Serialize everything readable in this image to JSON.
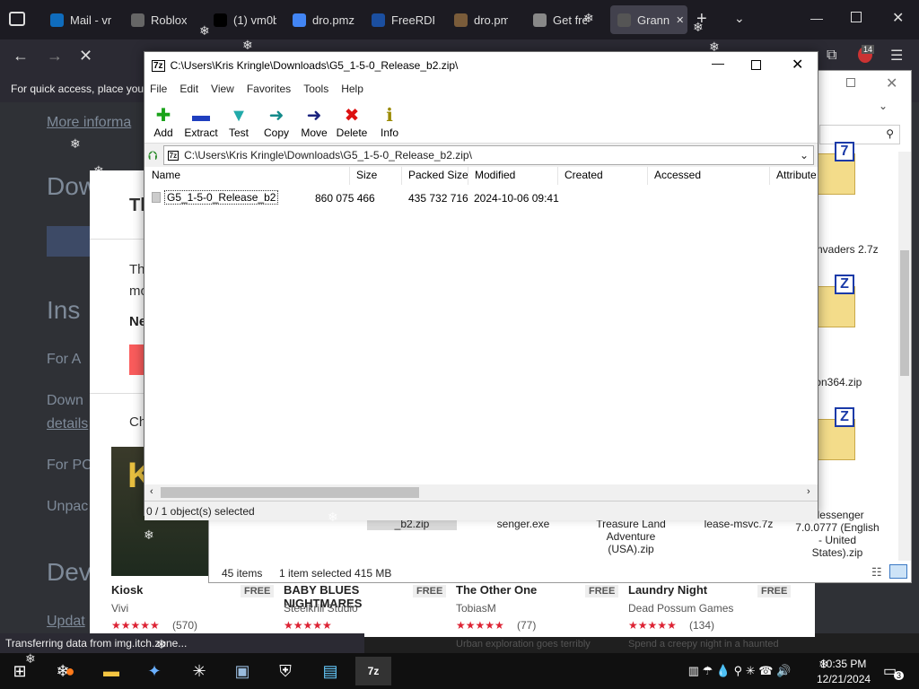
{
  "browser": {
    "tabs": [
      {
        "label": "Mail - vr",
        "icon": "mail-icon",
        "color": "#0f6cbd"
      },
      {
        "label": "Roblox",
        "icon": "roblox-icon",
        "color": "#666"
      },
      {
        "label": "(1) vm0b",
        "icon": "x-icon",
        "color": "#000"
      },
      {
        "label": "dro.pmz",
        "icon": "google-icon",
        "color": "#4285f4"
      },
      {
        "label": "FreeRDP",
        "icon": "freerdp-icon",
        "color": "#1b4fa0"
      },
      {
        "label": "dro.pm/",
        "icon": "file-icon",
        "color": "#7a5c3a"
      },
      {
        "label": "Get fre",
        "icon": "gear-icon",
        "color": "#888"
      },
      {
        "label": "Grann",
        "icon": "itchio-icon",
        "color": "#555"
      }
    ],
    "bookmark_text": "For quick access, place your",
    "status_text": "Transferring data from img.itch.zone...",
    "ext_badge": "14"
  },
  "page": {
    "more_info": "More informa",
    "texts": [
      "Dow",
      "Ins",
      "For A",
      "Down",
      "details",
      "For PC",
      "Unpac",
      "Dev"
    ],
    "modal_title": "Th",
    "modal_sub": "Th",
    "modal_sub2": "mo",
    "modal_ne": "Ne",
    "modal_ch": "Ch",
    "games": [
      {
        "title": "Kiosk",
        "badge": "FREE",
        "author": "Vivi",
        "rating": "(570)",
        "desc": ""
      },
      {
        "title": "BABY BLUES NIGHTMARES",
        "badge": "FREE",
        "author": "Steelkrill Studio",
        "rating": "",
        "desc": ""
      },
      {
        "title": "The Other One",
        "badge": "FREE",
        "author": "TobiasM",
        "rating": "(77)",
        "desc": "Urban exploration goes terribly"
      },
      {
        "title": "Laundry Night",
        "badge": "FREE",
        "author": "Dead Possum Games",
        "rating": "(134)",
        "desc": "Spend a creepy night in a haunted"
      }
    ]
  },
  "explorer": {
    "items": [
      {
        "label": "kenInvaders 2.7z",
        "badge": "7"
      },
      {
        "label": "ion364.zip",
        "badge": "Z"
      },
      {
        "label": "Messenger 7.0.0777 (English - United States).zip",
        "badge": "Z"
      }
    ],
    "bottom_labels": [
      "_b2.zip",
      "senger.exe",
      "Treasure Land Adventure (USA).zip",
      "lease-msvc.7z"
    ],
    "status_items": "45 items",
    "status_selected": "1 item selected  415 MB"
  },
  "zip": {
    "title": "C:\\Users\\Kris Kringle\\Downloads\\G5_1-5-0_Release_b2.zip\\",
    "menu": [
      "File",
      "Edit",
      "View",
      "Favorites",
      "Tools",
      "Help"
    ],
    "tools": [
      {
        "label": "Add",
        "glyph": "✚",
        "color": "#1aa31a"
      },
      {
        "label": "Extract",
        "glyph": "▬",
        "color": "#1f3fbf"
      },
      {
        "label": "Test",
        "glyph": "▼",
        "color": "#22aaaa"
      },
      {
        "label": "Copy",
        "glyph": "➜",
        "color": "#138a8a"
      },
      {
        "label": "Move",
        "glyph": "➜",
        "color": "#1a237e"
      },
      {
        "label": "Delete",
        "glyph": "✖",
        "color": "#d11"
      },
      {
        "label": "Info",
        "glyph": "ℹ",
        "color": "#9a8a00"
      }
    ],
    "address": "C:\\Users\\Kris Kringle\\Downloads\\G5_1-5-0_Release_b2.zip\\",
    "columns": [
      "Name",
      "Size",
      "Packed Size",
      "Modified",
      "Created",
      "Accessed",
      "Attribute"
    ],
    "row": {
      "name": "G5_1-5-0_Release_b2",
      "size": "860 075 466",
      "packed": "435 732 716",
      "modified": "2024-10-06 09:41"
    },
    "status": "0 / 1 object(s) selected"
  },
  "taskbar": {
    "time": "10:35 PM",
    "date": "12/21/2024",
    "notif": "3"
  }
}
